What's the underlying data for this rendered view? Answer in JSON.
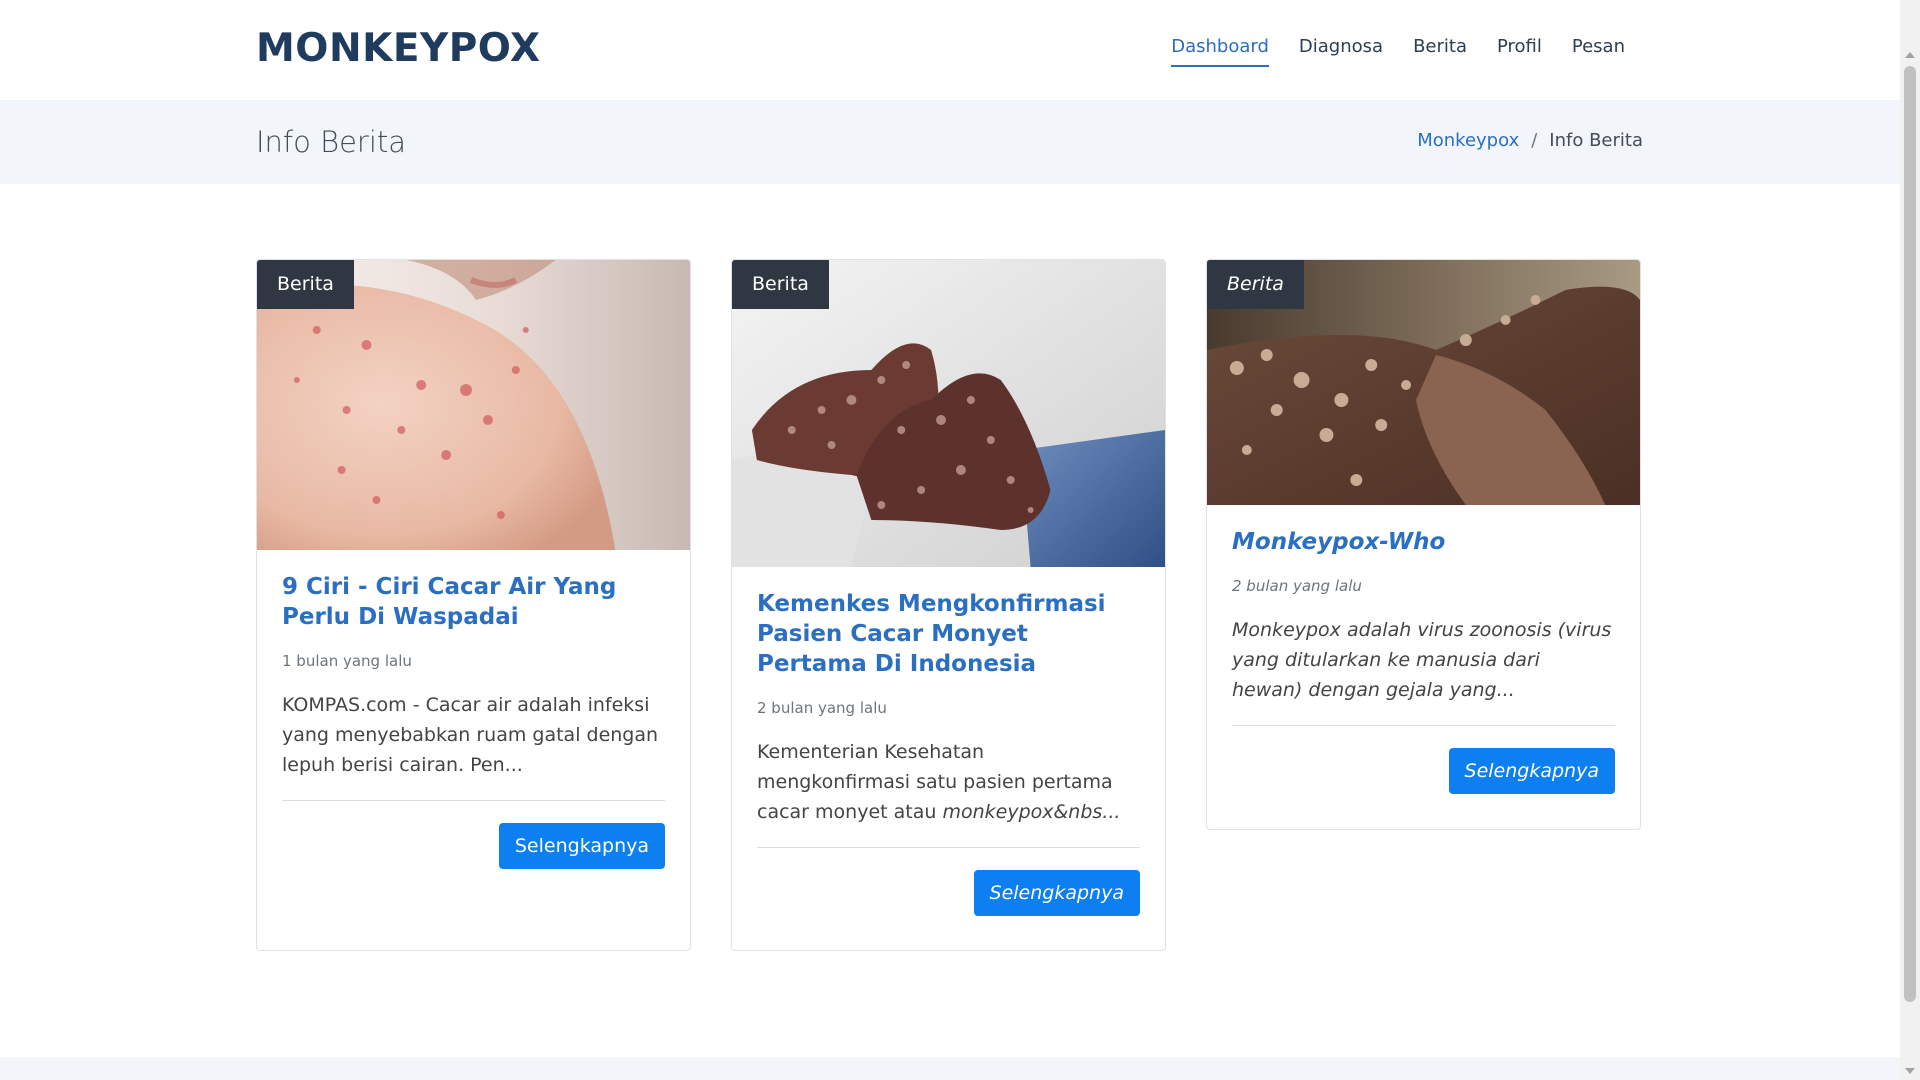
{
  "header": {
    "logo": "MONKEYPOX",
    "nav": [
      "Dashboard",
      "Diagnosa",
      "Berita",
      "Profil",
      "Pesan"
    ],
    "active_nav": "Dashboard"
  },
  "band": {
    "title": "Info Berita",
    "breadcrumb_home": "Monkeypox",
    "breadcrumb_separator": "/",
    "breadcrumb_current": "Info Berita"
  },
  "cards": [
    {
      "badge": "Berita",
      "title": "9 Ciri - Ciri Cacar Air Yang Perlu Di Waspadai",
      "date": "1 bulan yang lalu",
      "excerpt": "KOMPAS.com - Cacar air adalah infeksi yang menyebabkan ruam gatal dengan lepuh berisi cairan. Pen...",
      "button": "Selengkapnya",
      "image": "child-back-rash-photo"
    },
    {
      "badge": "Berita",
      "title": "Kemenkes Mengkonfirmasi Pasien Cacar Monyet Pertama Di Indonesia",
      "date": "2 bulan yang lalu",
      "excerpt_plain": "Kementerian Kesehatan mengkonfirmasi satu pasien pertama cacar monyet atau ",
      "excerpt_italic": "monkeypox&nbs...",
      "button": "Selengkapnya",
      "image": "feet-lesions-photo"
    },
    {
      "badge": "Berita",
      "title": "Monkeypox-Who",
      "date": "2 bulan yang lalu",
      "excerpt": "Monkeypox adalah virus zoonosis (virus yang ditularkan ke manusia dari hewan) dengan gejala yang...",
      "button": "Selengkapnya",
      "image": "hand-lesions-photo"
    }
  ],
  "colors": {
    "accent": "#2a6fc2",
    "button": "#0d7ff0",
    "badge": "#2f3842",
    "band": "#f2f6fb"
  }
}
